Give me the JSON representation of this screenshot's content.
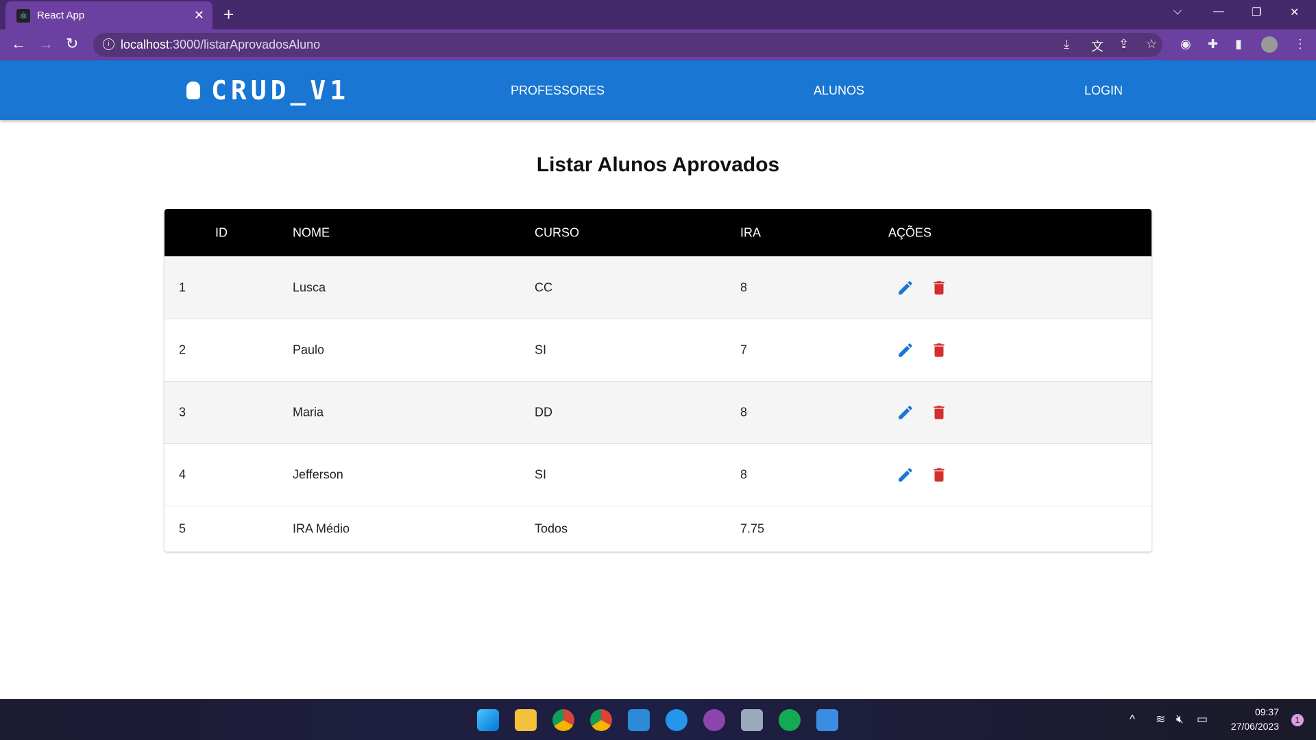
{
  "browser": {
    "tab_title": "React App",
    "url_host": "localhost",
    "url_path": ":3000/listarAprovadosAluno"
  },
  "header": {
    "logo": "CRUD_V1",
    "menu": [
      "PROFESSORES",
      "ALUNOS",
      "LOGIN"
    ]
  },
  "page": {
    "title": "Listar Alunos Aprovados"
  },
  "table": {
    "columns": [
      "ID",
      "NOME",
      "CURSO",
      "IRA",
      "AÇÕES"
    ],
    "rows": [
      {
        "id": "1",
        "nome": "Lusca",
        "curso": "CC",
        "ira": "8"
      },
      {
        "id": "2",
        "nome": "Paulo",
        "curso": "SI",
        "ira": "7"
      },
      {
        "id": "3",
        "nome": "Maria",
        "curso": "DD",
        "ira": "8"
      },
      {
        "id": "4",
        "nome": "Jefferson",
        "curso": "SI",
        "ira": "8"
      }
    ],
    "summary": {
      "id": "5",
      "nome": "IRA Médio",
      "curso": "Todos",
      "ira": "7.75"
    }
  },
  "colors": {
    "header": "#1976d2",
    "edit": "#1976d2",
    "delete": "#d32f2f"
  },
  "taskbar": {
    "time": "09:37",
    "date": "27/06/2023",
    "notifications": "1"
  }
}
